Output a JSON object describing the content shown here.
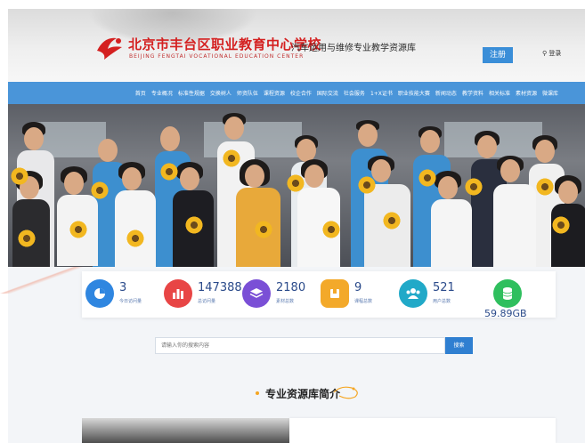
{
  "header": {
    "school_name": "北京市丰台区职业教育中心学校",
    "school_name_en": "BEIJING FENGTAI VOCATIONAL EDUCATION CENTER",
    "site_title": "汽车运用与维修专业教学资源库",
    "register_label": "注册",
    "login_label": "登录"
  },
  "nav": {
    "items": [
      "首页",
      "专业概况",
      "标准性规据",
      "交换树人",
      "师资队伍",
      "课程资源",
      "校企合作",
      "国际交流",
      "社会服务",
      "1+X证书",
      "职业技能大赛",
      "新闻动态",
      "教学资料",
      "相关标准",
      "素材资源",
      "微课库"
    ]
  },
  "stats": [
    {
      "value": "3",
      "label": "今日访问量",
      "icon": "pie-icon",
      "color": "#2f86e0"
    },
    {
      "value": "147388",
      "label": "总访问量",
      "icon": "bar-chart-icon",
      "color": "#e84545"
    },
    {
      "value": "2180",
      "label": "素材总数",
      "icon": "layers-icon",
      "color": "#7a4fd6"
    },
    {
      "value": "9",
      "label": "课程总数",
      "icon": "book-icon",
      "color": "#f3a92a"
    },
    {
      "value": "521",
      "label": "用户总数",
      "icon": "users-icon",
      "color": "#21a9c8"
    },
    {
      "value": "59.89GB",
      "label": "",
      "icon": "database-icon",
      "color": "#2fbf5e"
    }
  ],
  "search": {
    "placeholder": "请输入你的搜索内容",
    "button_label": "搜索"
  },
  "section": {
    "title": "专业资源库简介"
  }
}
